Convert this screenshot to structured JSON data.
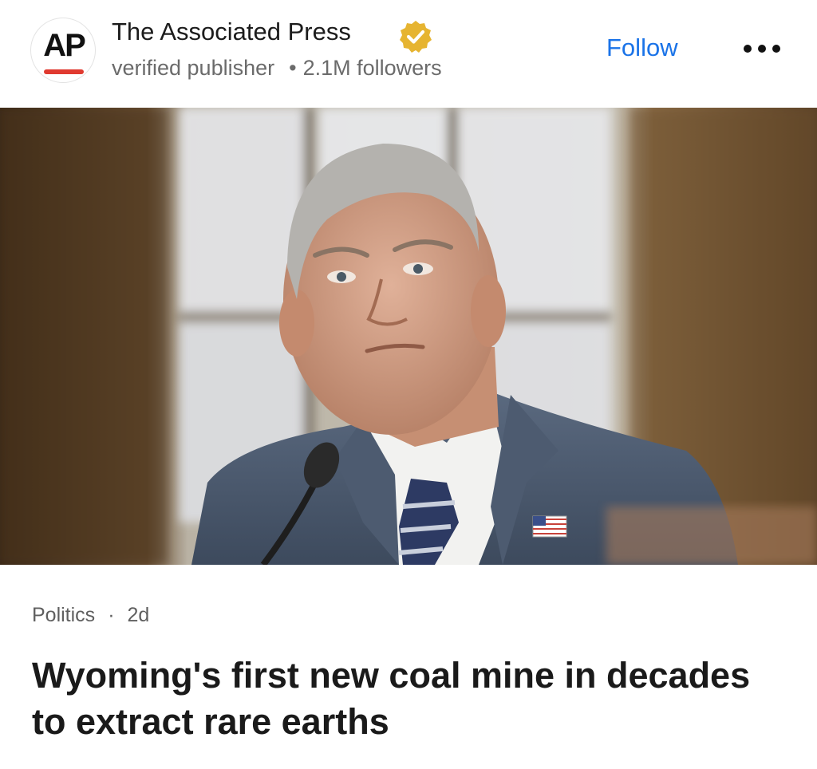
{
  "publisher": {
    "logo_text": "AP",
    "name": "The Associated Press",
    "verified_label": "verified publisher",
    "followers": "2.1M followers",
    "follow_label": "Follow",
    "separator": "•"
  },
  "article": {
    "category": "Politics",
    "separator": "·",
    "age": "2d",
    "headline": "Wyoming's first new coal mine in decades to extract rare earths"
  },
  "icons": {
    "verified": "verified-check-badge-icon",
    "more": "more-horizontal-icon"
  },
  "colors": {
    "accent_blue": "#1a73e8",
    "badge_gold": "#e6b431",
    "ap_red": "#e03a30"
  }
}
